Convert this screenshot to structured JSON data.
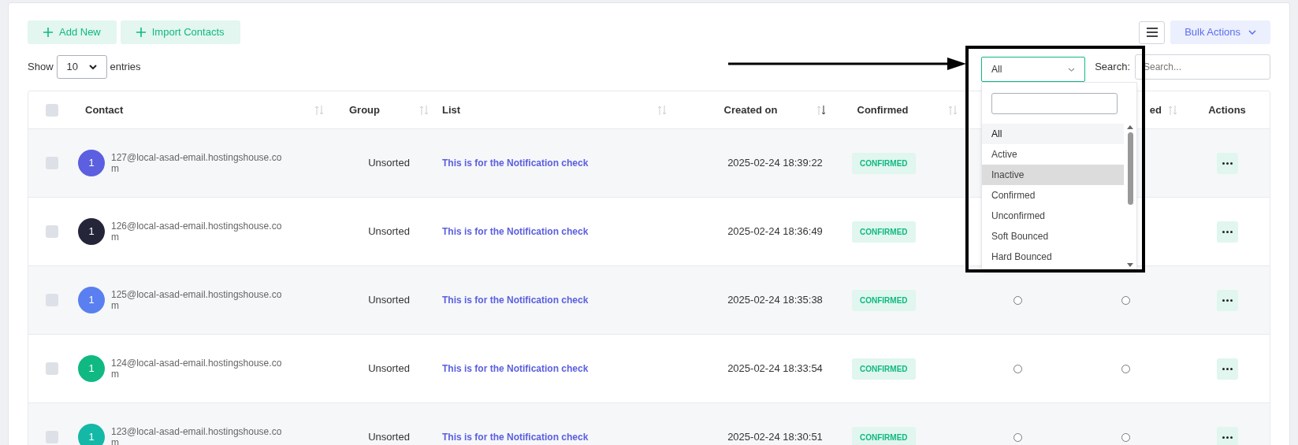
{
  "toolbar": {
    "buttons": [
      {
        "label": "Add New"
      },
      {
        "label": "Import Contacts"
      }
    ],
    "bulk_actions": "Bulk Actions"
  },
  "length": {
    "show": "Show",
    "value": "10",
    "entries": "entries"
  },
  "search": {
    "label": "Search:",
    "placeholder": "Search..."
  },
  "status_filter": {
    "value": "All",
    "options": [
      {
        "label": "All",
        "selected": true,
        "highlighted": false
      },
      {
        "label": "Active",
        "selected": false,
        "highlighted": false
      },
      {
        "label": "Inactive",
        "selected": false,
        "highlighted": true
      },
      {
        "label": "Confirmed",
        "selected": false,
        "highlighted": false
      },
      {
        "label": "Unconfirmed",
        "selected": false,
        "highlighted": false
      },
      {
        "label": "Soft Bounced",
        "selected": false,
        "highlighted": false
      },
      {
        "label": "Hard Bounced",
        "selected": false,
        "highlighted": false
      }
    ]
  },
  "table": {
    "all_checked": false,
    "columns": [
      "Contact",
      "Group",
      "List",
      "Created on",
      "Confirmed",
      "",
      "ed",
      "Actions"
    ],
    "rows": [
      {
        "checked": false,
        "initial": "1",
        "color": "#5b5fe0",
        "email": "127@local-asad-email.hostingshouse.com",
        "group": "Unsorted",
        "list": "This is for the Notification check",
        "created": "2025-02-24 18:39:22",
        "confirmed": "CONFIRMED",
        "radios": []
      },
      {
        "checked": false,
        "initial": "1",
        "color": "#25253a",
        "email": "126@local-asad-email.hostingshouse.com",
        "group": "Unsorted",
        "list": "This is for the Notification check",
        "created": "2025-02-24 18:36:49",
        "confirmed": "CONFIRMED",
        "radios": []
      },
      {
        "checked": false,
        "initial": "1",
        "color": "#5a7ff0",
        "email": "125@local-asad-email.hostingshouse.com",
        "group": "Unsorted",
        "list": "This is for the Notification check",
        "created": "2025-02-24 18:35:38",
        "confirmed": "CONFIRMED",
        "radios": [
          {
            "checked": false
          },
          {
            "checked": false
          }
        ]
      },
      {
        "checked": false,
        "initial": "1",
        "color": "#10b981",
        "email": "124@local-asad-email.hostingshouse.com",
        "group": "Unsorted",
        "list": "This is for the Notification check",
        "created": "2025-02-24 18:33:54",
        "confirmed": "CONFIRMED",
        "radios": [
          {
            "checked": false
          },
          {
            "checked": false
          }
        ]
      },
      {
        "checked": false,
        "initial": "1",
        "color": "#14b8a6",
        "email": "123@local-asad-email.hostingshouse.com",
        "group": "Unsorted",
        "list": "This is for the Notification check",
        "created": "2025-02-24 18:30:51",
        "confirmed": "CONFIRMED",
        "radios": [
          {
            "checked": false
          },
          {
            "checked": false
          }
        ]
      }
    ]
  }
}
